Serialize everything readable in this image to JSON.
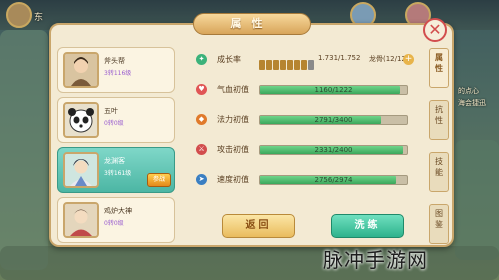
{
  "panel": {
    "title": "属性"
  },
  "bg": {
    "top_left_label": "东",
    "banner_line1": "的点心",
    "banner_line2": "海会捷迅"
  },
  "pets": [
    {
      "name": "斧头帮",
      "level": "3转116级",
      "portrait": "warrior-portrait-icon"
    },
    {
      "name": "五叶",
      "level": "0转0级",
      "portrait": "panda-portrait-icon"
    },
    {
      "name": "龙渊客",
      "level": "3转161级",
      "portrait": "swordsman-portrait-icon",
      "badge": "参战",
      "selected": true
    },
    {
      "name": "鸡炉大神",
      "level": "0转0级",
      "portrait": "sage-portrait-icon"
    }
  ],
  "growth": {
    "label": "成长率",
    "value": "1.731/1.752",
    "longgu": "龙骨(12/12)",
    "pips_filled": 7,
    "pips_total": 8
  },
  "stats": [
    {
      "label": "气血初值",
      "value": "1160/1222",
      "fill": 0.949,
      "icon": "heart-icon",
      "color": "#e05555"
    },
    {
      "label": "法力初值",
      "value": "2791/3400",
      "fill": 0.821,
      "icon": "mana-icon",
      "color": "#e07a2b"
    },
    {
      "label": "攻击初值",
      "value": "2331/2400",
      "fill": 0.971,
      "icon": "sword-icon",
      "color": "#d24d4d"
    },
    {
      "label": "速度初值",
      "value": "2756/2974",
      "fill": 0.927,
      "icon": "speed-icon",
      "color": "#3a7fc2"
    }
  ],
  "buttons": {
    "back": "返回",
    "wash": "洗练"
  },
  "side_tabs": [
    "属性",
    "抗性",
    "技能",
    "图鉴"
  ],
  "watermark": "脉冲手游网"
}
